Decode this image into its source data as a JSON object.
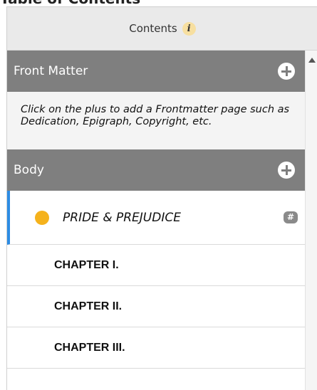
{
  "page_top_cut_text": "Table of Contents",
  "panel": {
    "title": "Contents",
    "info_icon_glyph": "i"
  },
  "front_matter": {
    "label": "Front Matter",
    "add_icon": "plus-circle-icon",
    "hint": "Click on the plus to add a Frontmatter page such as Dedication, Epigraph, Copyright, etc."
  },
  "body_section": {
    "label": "Body",
    "add_icon": "plus-circle-icon"
  },
  "book": {
    "title": "PRIDE & PREJUDICE",
    "status_color": "#f5b21c",
    "selected_accent": "#2d8ce3",
    "hash_glyph": "#"
  },
  "chapters": [
    {
      "title": "CHAPTER I."
    },
    {
      "title": "CHAPTER II."
    },
    {
      "title": "CHAPTER III."
    }
  ]
}
